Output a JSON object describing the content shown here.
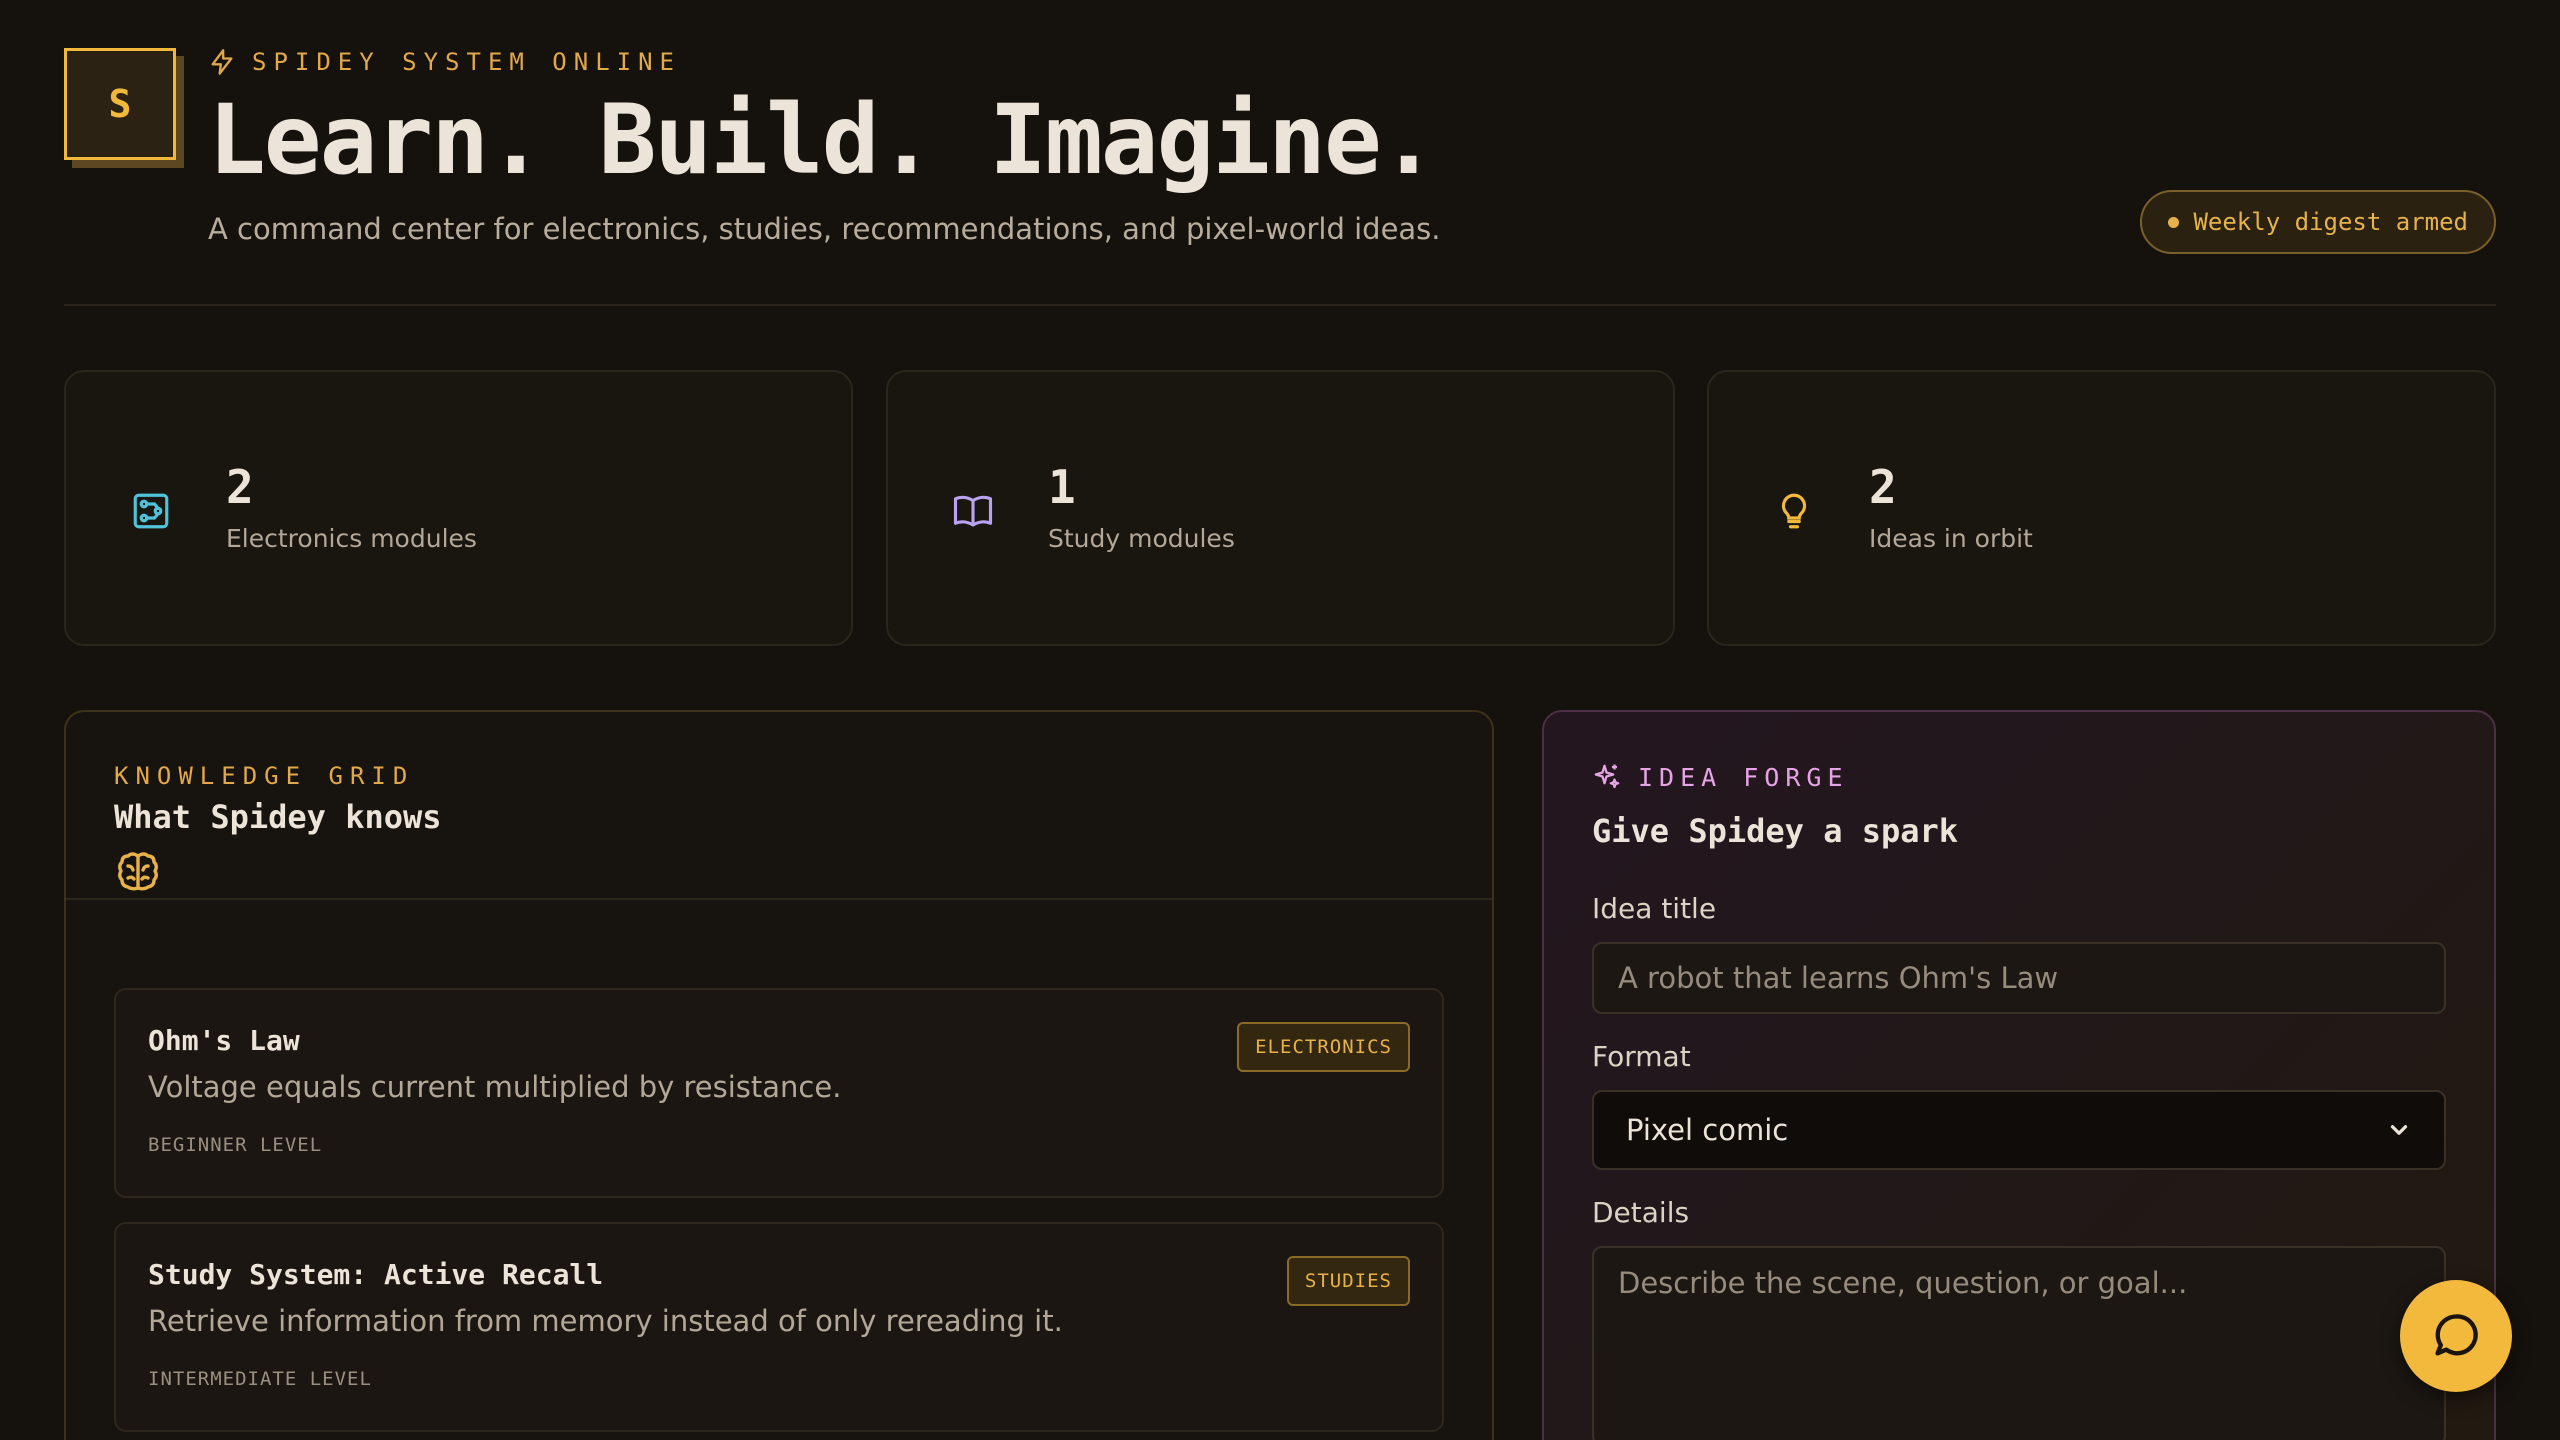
{
  "header": {
    "logo_letter": "S",
    "status": "SPIDEY SYSTEM ONLINE",
    "headline": "Learn. Build. Imagine.",
    "subtitle": "A command center for electronics, studies, recommendations, and pixel-world ideas.",
    "digest_badge": "Weekly digest armed"
  },
  "stats": [
    {
      "value": "2",
      "label": "Electronics modules",
      "icon": "circuit-icon",
      "color": "#4fc3d9"
    },
    {
      "value": "1",
      "label": "Study modules",
      "icon": "book-open-icon",
      "color": "#b9a3f0"
    },
    {
      "value": "2",
      "label": "Ideas in orbit",
      "icon": "lightbulb-icon",
      "color": "#f1b83b"
    }
  ],
  "knowledge": {
    "kicker": "KNOWLEDGE GRID",
    "title": "What Spidey knows",
    "items": [
      {
        "title": "Ohm's Law",
        "description": "Voltage equals current multiplied by resistance.",
        "level": "BEGINNER LEVEL",
        "tag": "ELECTRONICS"
      },
      {
        "title": "Study System: Active Recall",
        "description": "Retrieve information from memory instead of only rereading it.",
        "level": "INTERMEDIATE LEVEL",
        "tag": "STUDIES"
      }
    ]
  },
  "forge": {
    "kicker": "IDEA FORGE",
    "title": "Give Spidey a spark",
    "idea_title_label": "Idea title",
    "idea_title_placeholder": "A robot that learns Ohm's Law",
    "format_label": "Format",
    "format_value": "Pixel comic",
    "details_label": "Details",
    "details_placeholder": "Describe the scene, question, or goal..."
  },
  "colors": {
    "accent": "#f1b83b",
    "background": "#15110d",
    "forge_accent": "#e6a3e6"
  }
}
